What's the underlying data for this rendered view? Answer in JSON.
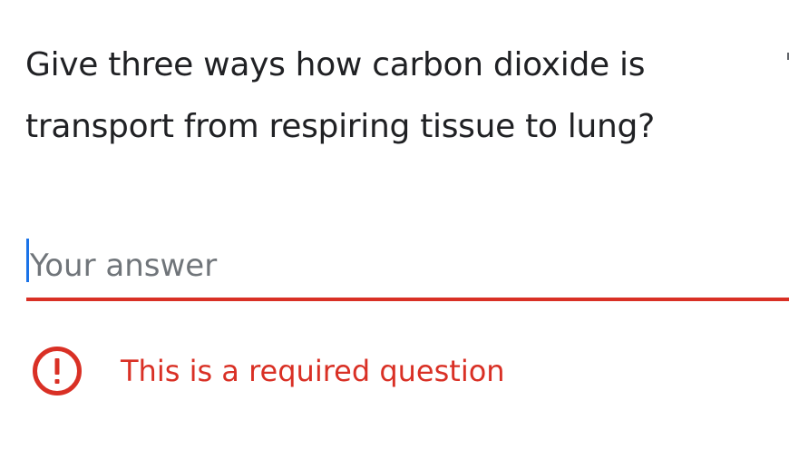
{
  "question": {
    "title": "Give three ways how carbon dioxide is transport from respiring tissue to lung?"
  },
  "answer": {
    "placeholder": "Your answer",
    "value": ""
  },
  "validation": {
    "icon": "error-icon",
    "message": "This is a required question",
    "color": "#d93025"
  },
  "colors": {
    "text": "#202124",
    "placeholder": "#70757a",
    "focus": "#1a73e8",
    "error": "#d93025"
  }
}
